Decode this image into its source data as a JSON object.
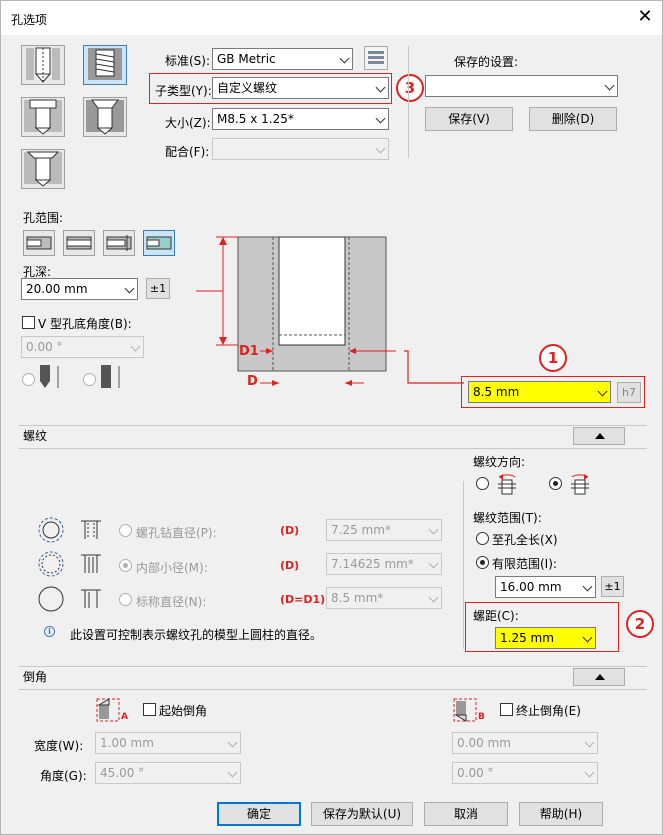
{
  "window": {
    "title": "孔选项",
    "close": "✕"
  },
  "top": {
    "standard_label": "标准(S):",
    "standard_value": "GB Metric",
    "subtype_label": "子类型(Y):",
    "subtype_value": "自定义螺纹",
    "size_label": "大小(Z):",
    "size_value": "M8.5 x 1.25*",
    "fit_label": "配合(F):",
    "fit_value": "",
    "saved_label": "保存的设置:",
    "saved_value": "",
    "save_btn": "保存(V)",
    "delete_btn": "删除(D)"
  },
  "extent": {
    "label": "孔范围:",
    "depth_label": "孔深:",
    "depth_value": "20.00 mm",
    "pm": "±1",
    "vangle_label": "V 型孔底角度(B):",
    "vangle_value": "0.00 °"
  },
  "diagram": {
    "d1": "D1",
    "d": "D",
    "diameter_value": "8.5 mm",
    "h7": "h7"
  },
  "thread": {
    "section": "螺纹",
    "tap_drill_label": "螺孔钻直径(P):",
    "tap_drill_tag": "(D)",
    "tap_drill_value": "7.25 mm*",
    "minor_label": "内部小径(M):",
    "minor_tag": "(D)",
    "minor_value": "7.14625 mm*",
    "nominal_label": "标称直径(N):",
    "nominal_tag": "(D=D1)",
    "nominal_value": "8.5 mm*",
    "info": "此设置可控制表示螺纹孔的模型上圆柱的直径。",
    "direction_label": "螺纹方向:",
    "range_label": "螺纹范围(T):",
    "full_length": "至孔全长(X)",
    "finite": "有限范围(I):",
    "finite_value": "16.00 mm",
    "pm": "±1",
    "pitch_label": "螺距(C):",
    "pitch_value": "1.25 mm"
  },
  "chamfer": {
    "section": "倒角",
    "start_label": "起始倒角",
    "end_label": "终止倒角(E)",
    "width_label": "宽度(W):",
    "angle_label": "角度(G):",
    "start_width": "1.00 mm",
    "start_angle": "45.00 °",
    "end_width": "0.00 mm",
    "end_angle": "0.00 °",
    "tag_a": "A",
    "tag_b": "B"
  },
  "buttons": {
    "ok": "确定",
    "save_default": "保存为默认(U)",
    "cancel": "取消",
    "help": "帮助(H)"
  },
  "callouts": {
    "c1": "1",
    "c2": "2",
    "c3": "3"
  },
  "colors": {
    "highlight": "#ffff00",
    "callout": "#dd2222",
    "accent": "#0078d7"
  }
}
